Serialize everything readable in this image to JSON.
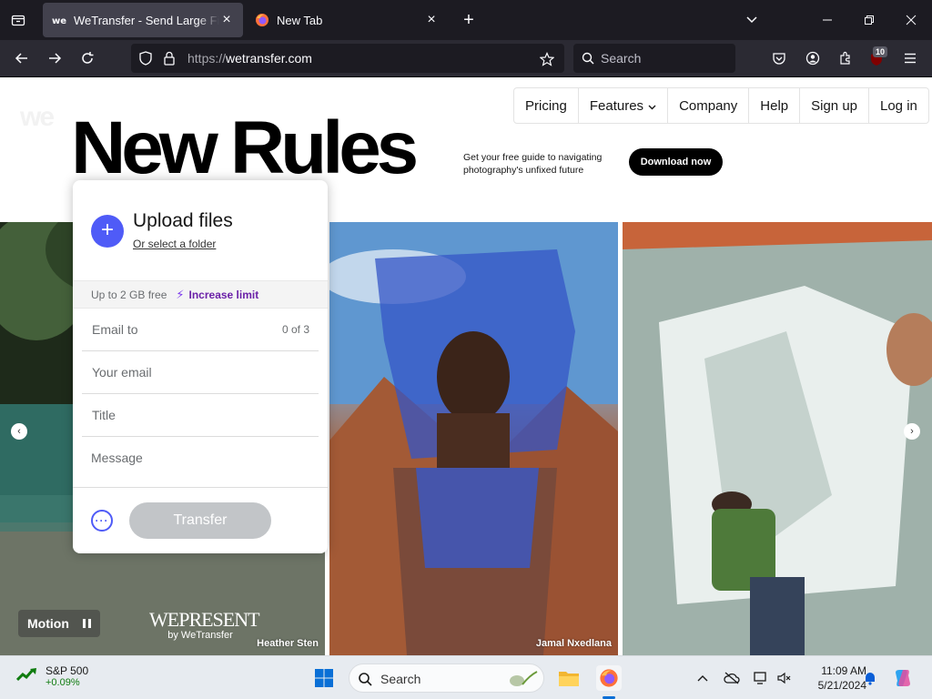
{
  "browser": {
    "tabs": [
      {
        "title": "WeTransfer - Send Large Files & Share Photos Online",
        "active": true
      },
      {
        "title": "New Tab",
        "active": false
      }
    ],
    "url_prefix": "https://",
    "url_host": "wetransfer.com",
    "search_placeholder": "Search",
    "extension_badge": "10"
  },
  "page": {
    "logo": "we",
    "nav": [
      "Pricing",
      "Features",
      "Company",
      "Help",
      "Sign up",
      "Log in"
    ],
    "features_chevron": "⌄",
    "headline": "New Rules",
    "promo_text": "Get your free guide to navigating photography's unfixed future",
    "download_button": "Download now",
    "upload": {
      "title": "Upload files",
      "subtitle": "Or select a folder",
      "limit_text": "Up to 2 GB free",
      "limit_link": "Increase limit",
      "email_to": "Email to",
      "email_count": "0 of 3",
      "your_email": "Your email",
      "title_field": "Title",
      "message_field": "Message",
      "transfer_button": "Transfer"
    },
    "motion_label": "Motion",
    "wepresent": "WEPRESENT",
    "wepresent_sub": "by WeTransfer",
    "credits": [
      "Heather Sten",
      "Jamal Nxedlana"
    ]
  },
  "taskbar": {
    "stock_name": "S&P 500",
    "stock_change": "+0.09%",
    "search_placeholder": "Search",
    "time": "11:09 AM",
    "date": "5/21/2024"
  },
  "colors": {
    "accent_blue": "#4f5bf7",
    "limit_purple": "#6b21a8",
    "transfer_disabled": "#c2c5c8",
    "browser_bg": "#1c1b22",
    "toolbar_bg": "#2b2a33"
  },
  "icons": [
    "tab-list-icon",
    "firefox-icon",
    "wetransfer-favicon",
    "back-icon",
    "forward-icon",
    "reload-icon",
    "shield-icon",
    "lock-icon",
    "star-icon",
    "search-icon",
    "pocket-icon",
    "account-icon",
    "extensions-icon",
    "ublock-icon",
    "menu-icon",
    "windows-start-icon",
    "file-explorer-icon"
  ]
}
